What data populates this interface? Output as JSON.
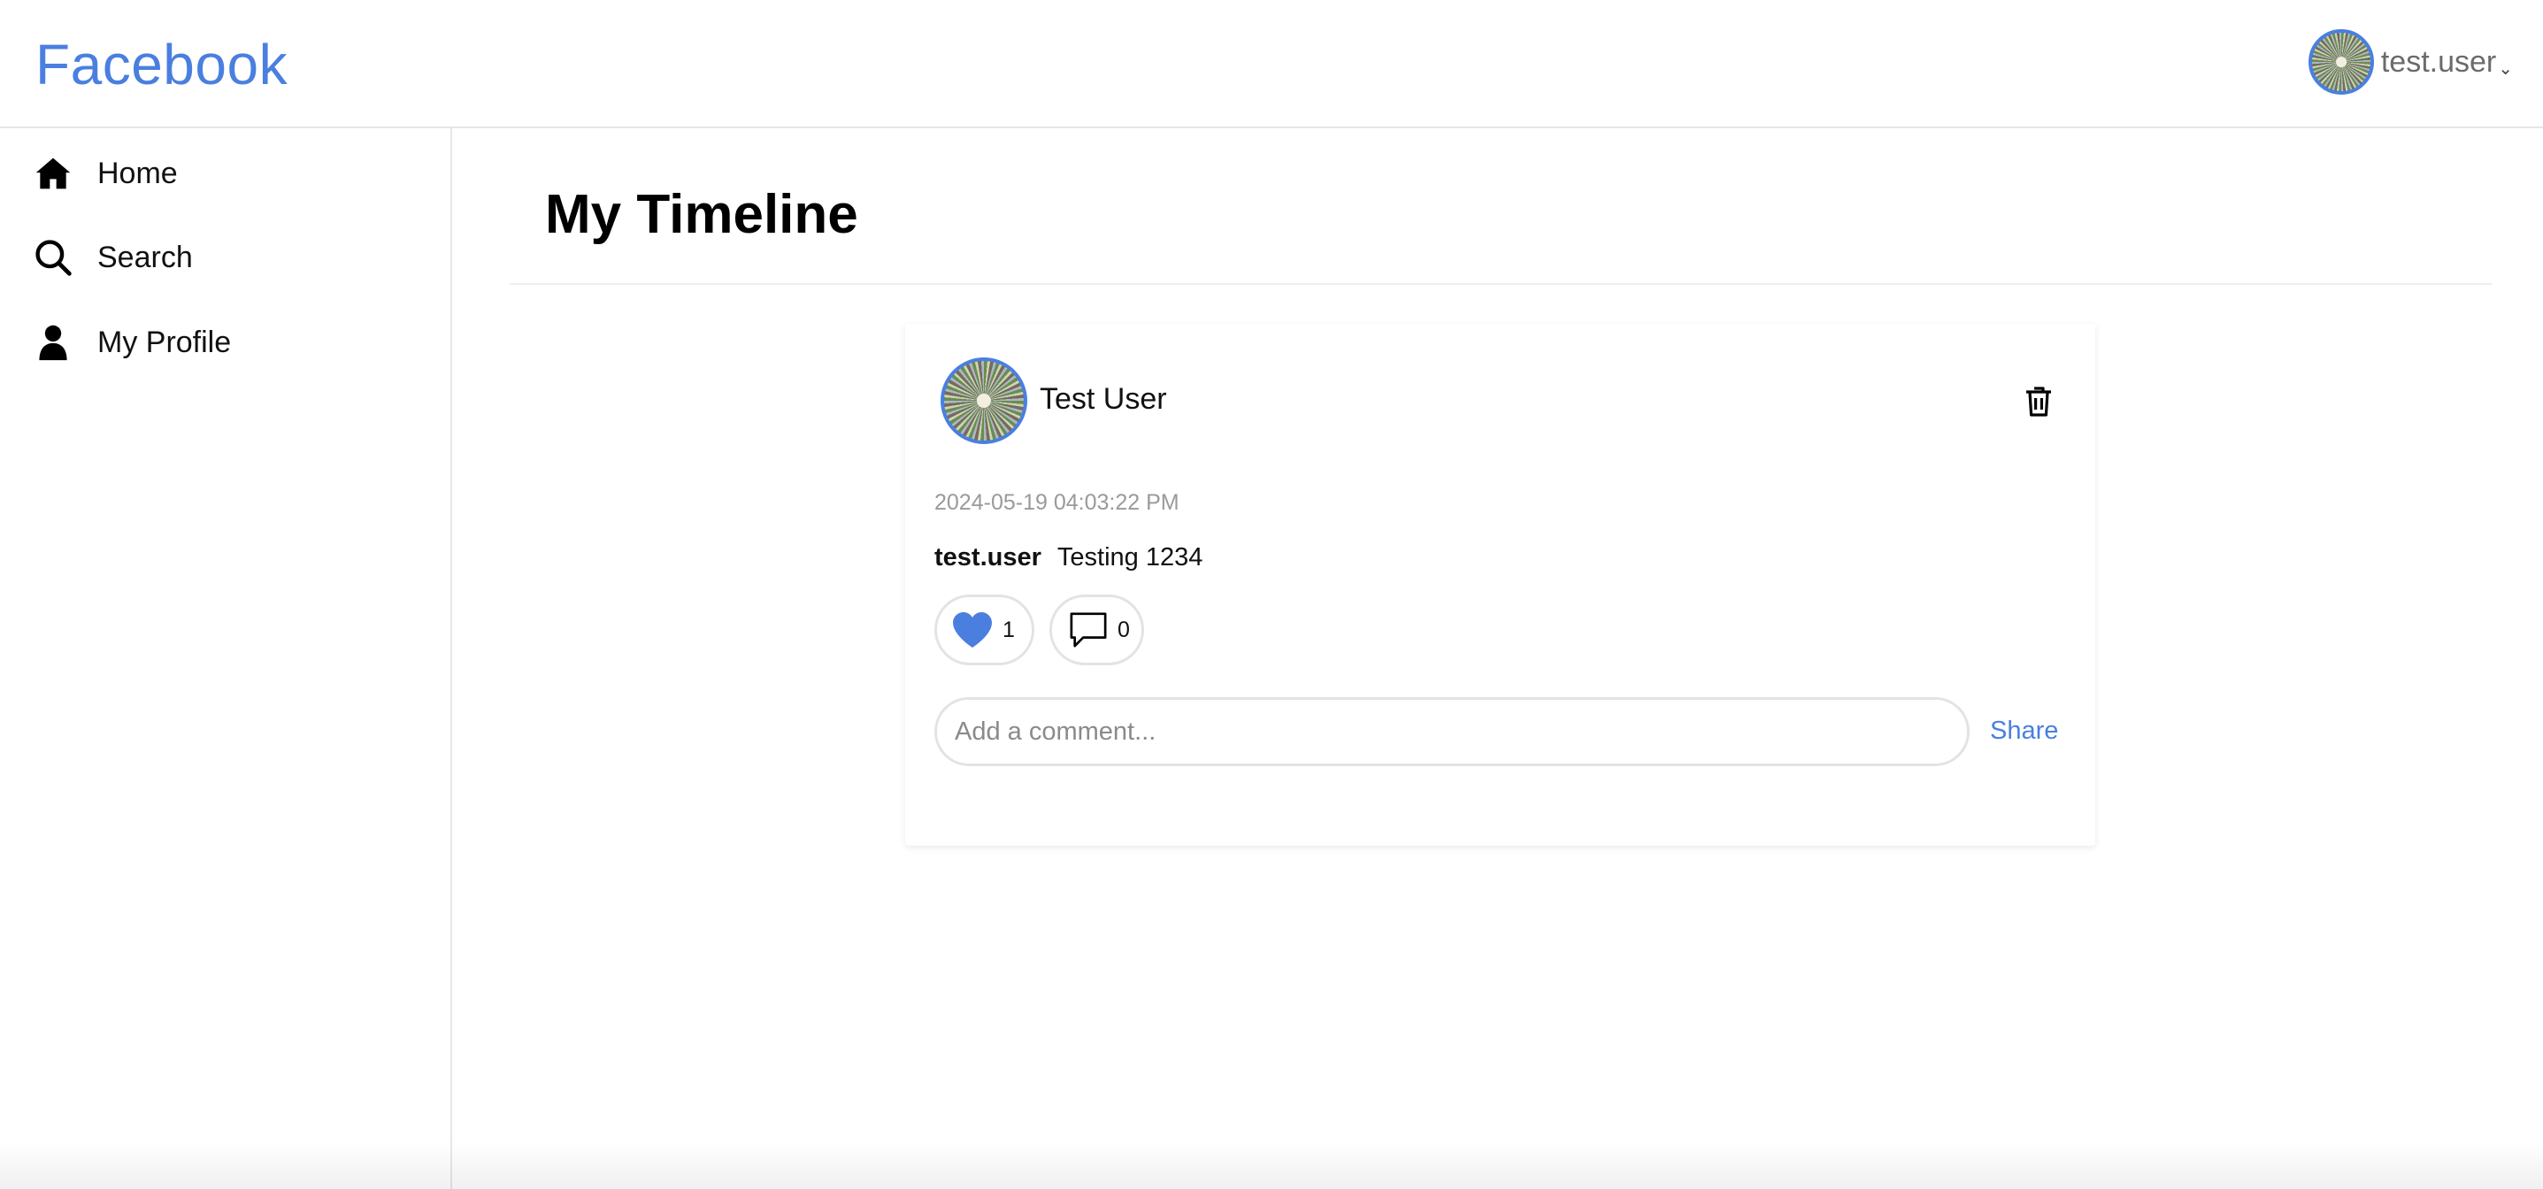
{
  "header": {
    "brand": "Facebook",
    "user": {
      "name": "test.user",
      "chevron": "⌄"
    }
  },
  "sidebar": {
    "items": [
      {
        "label": "Home",
        "icon": "home-icon"
      },
      {
        "label": "Search",
        "icon": "search-icon"
      },
      {
        "label": "My Profile",
        "icon": "user-icon"
      }
    ]
  },
  "main": {
    "title": "My Timeline",
    "post": {
      "author": "Test User",
      "timestamp": "2024-05-19 04:03:22 PM",
      "username": "test.user",
      "text": "Testing 1234",
      "likes": "1",
      "liked": true,
      "comments": "0",
      "comment_placeholder": "Add a comment...",
      "share_label": "Share"
    }
  },
  "colors": {
    "accent": "#4a7fe0",
    "border": "#e3e3e3",
    "muted": "#9a9a9a"
  }
}
